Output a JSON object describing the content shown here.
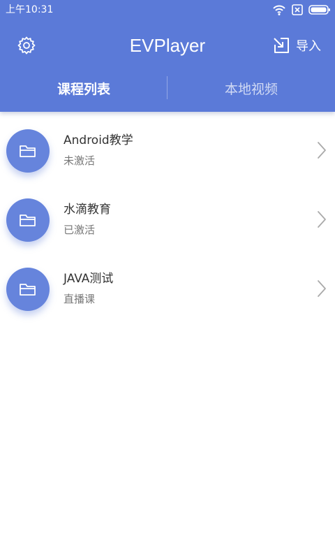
{
  "status_bar": {
    "time": "上午10:31",
    "icons": [
      "wifi-icon",
      "sim-error-icon",
      "battery-icon"
    ]
  },
  "header": {
    "title": "EVPlayer",
    "settings_icon": "gear-icon",
    "import_label": "导入",
    "import_icon": "import-arrow-icon"
  },
  "tabs": [
    {
      "label": "课程列表",
      "active": true
    },
    {
      "label": "本地视频",
      "active": false
    }
  ],
  "courses": [
    {
      "name": "Android教学",
      "status": "未激活",
      "icon": "folder-icon"
    },
    {
      "name": "水滴教育",
      "status": "已激活",
      "icon": "folder-icon"
    },
    {
      "name": "JAVA测试",
      "status": "直播课",
      "icon": "folder-icon"
    }
  ],
  "colors": {
    "primary": "#5b7ad8",
    "avatar": "#6684dc",
    "text_primary": "#333333",
    "text_secondary": "#777777",
    "arrow": "#aaaaaa"
  }
}
